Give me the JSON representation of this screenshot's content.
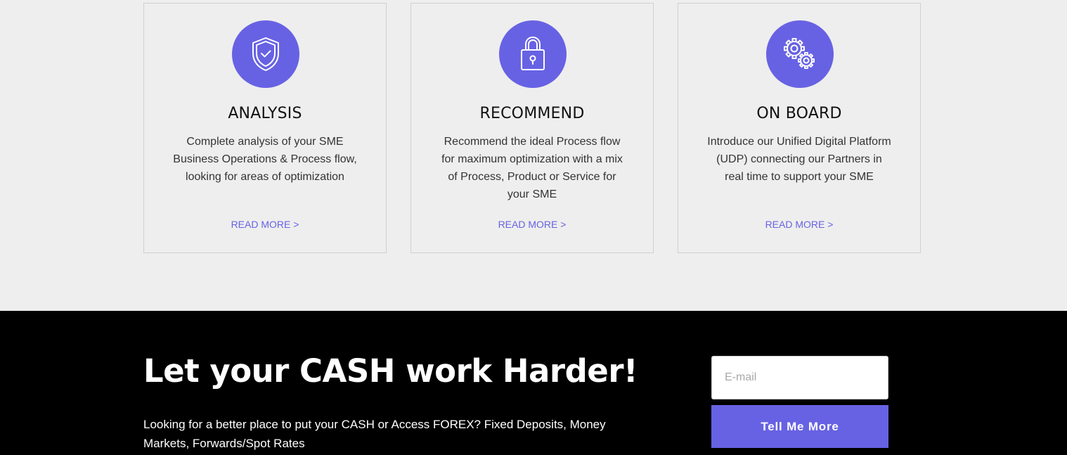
{
  "services": [
    {
      "icon": "shield-check-icon",
      "title": "ANALYSIS",
      "description": "Complete analysis of your SME Business Operations & Process flow, looking for areas of optimization",
      "link": "READ MORE >"
    },
    {
      "icon": "padlock-icon",
      "title": "RECOMMEND",
      "description": "Recommend the ideal Process flow for maximum optimization with a mix of Process, Product or Service for your SME",
      "link": "READ MORE >"
    },
    {
      "icon": "gears-icon",
      "title": "ON BOARD",
      "description": "Introduce our Unified Digital Platform (UDP) connecting our Partners in real time to support your SME",
      "link": "READ MORE >"
    }
  ],
  "cta": {
    "heading": "Let your CASH work Harder!",
    "text": "Looking for a better place to put your CASH or Access FOREX? Fixed Deposits, Money Markets, Forwards/Spot Rates",
    "email_placeholder": "E-mail",
    "email_value": "",
    "button_label": "Tell Me More"
  },
  "colors": {
    "accent": "#6762e3",
    "section_background": "#eeeeee",
    "cta_background": "#000000"
  }
}
